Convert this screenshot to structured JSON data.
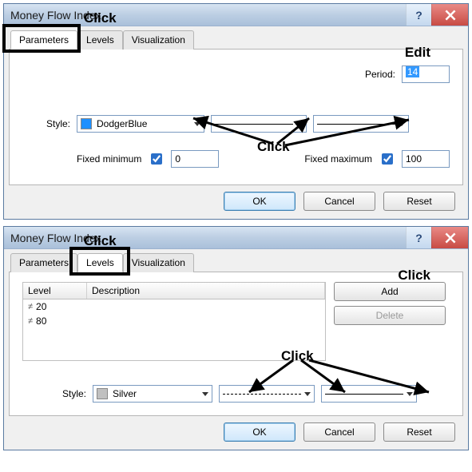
{
  "dialog1": {
    "title": "Money Flow Index",
    "tabs": {
      "parameters": "Parameters",
      "levels": "Levels",
      "visualization": "Visualization",
      "active": "parameters"
    },
    "period": {
      "label": "Period:",
      "value": "14"
    },
    "style": {
      "label": "Style:",
      "color_name": "DodgerBlue",
      "color_hex": "#1e90ff"
    },
    "fixedmin": {
      "label": "Fixed minimum",
      "checked": true,
      "value": "0"
    },
    "fixedmax": {
      "label": "Fixed maximum",
      "checked": true,
      "value": "100"
    },
    "buttons": {
      "ok": "OK",
      "cancel": "Cancel",
      "reset": "Reset"
    },
    "annotations": {
      "click_tab": "Click",
      "edit": "Edit",
      "click_style": "Click"
    }
  },
  "dialog2": {
    "title": "Money Flow Index",
    "tabs": {
      "parameters": "Parameters",
      "levels": "Levels",
      "visualization": "Visualization",
      "active": "levels"
    },
    "levels": {
      "columns": {
        "level": "Level",
        "description": "Description"
      },
      "rows": [
        {
          "value": "20",
          "description": ""
        },
        {
          "value": "80",
          "description": ""
        }
      ]
    },
    "side": {
      "add": "Add",
      "delete": "Delete"
    },
    "style": {
      "label": "Style:",
      "color_name": "Silver",
      "color_hex": "#c0c0c0"
    },
    "buttons": {
      "ok": "OK",
      "cancel": "Cancel",
      "reset": "Reset"
    },
    "annotations": {
      "click_tab": "Click",
      "click_add": "Click",
      "click_style": "Click"
    }
  }
}
